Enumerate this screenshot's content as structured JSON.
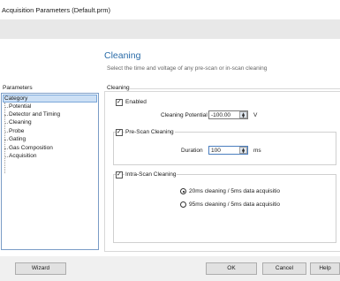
{
  "window": {
    "title": "Acquisition Parameters (Default.prm)"
  },
  "page": {
    "title": "Cleaning",
    "subtitle": "Select the time and voltage of any pre-scan or in-scan cleaning"
  },
  "parameters": {
    "label": "Parameters",
    "category": "Category",
    "items": [
      "Potential",
      "Detector and Timing",
      "Cleaning",
      "Probe",
      "Gating",
      "Gas Composition",
      "Acquisition"
    ]
  },
  "cleaning": {
    "section_label": "Cleaning",
    "enabled_label": "Enabled",
    "potential_label": "Cleaning Potential",
    "potential_value": "-100.00",
    "potential_unit": "V",
    "prescan_label": "Pre-Scan Cleaning",
    "duration_label": "Duration",
    "duration_value": "100",
    "duration_unit": "ms",
    "intrascan_label": "Intra-Scan Cleaning",
    "options": [
      "20ms cleaning / 5ms data acquisitio",
      "95ms cleaning / 5ms data acquisitio"
    ]
  },
  "buttons": {
    "wizard": "Wizard",
    "ok": "OK",
    "cancel": "Cancel",
    "help": "Help"
  },
  "icons": {
    "check": "checkmark-icon",
    "spin_up": "spin-up-icon",
    "spin_down": "spin-down-icon"
  }
}
